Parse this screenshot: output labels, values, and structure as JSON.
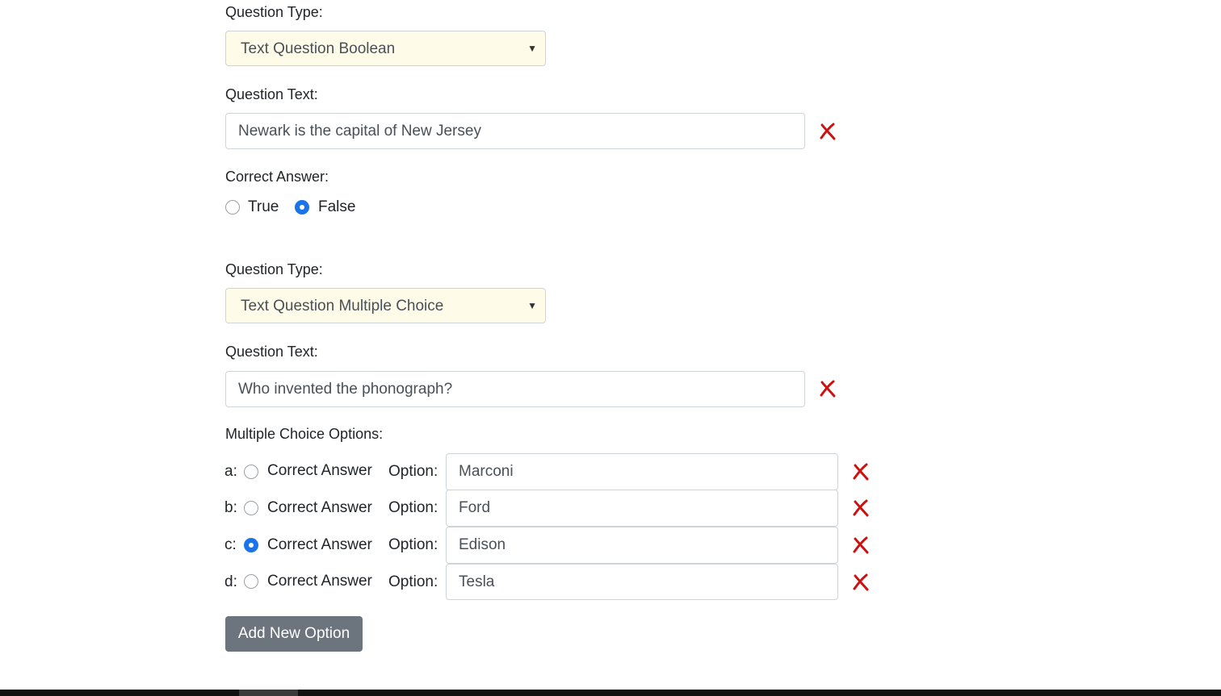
{
  "question1": {
    "type_label": "Question Type:",
    "type_value": "Text Question Boolean",
    "text_label": "Question Text:",
    "text_value": "Newark is the capital of New Jersey",
    "answer_label": "Correct Answer:",
    "answer_options": [
      "True",
      "False"
    ],
    "selected_answer": "False"
  },
  "question2": {
    "type_label": "Question Type:",
    "type_value": "Text Question Multiple Choice",
    "text_label": "Question Text:",
    "text_value": "Who invented the phonograph?",
    "options_label": "Multiple Choice Options:",
    "options": [
      {
        "letter": "a:",
        "correct_label": "Correct Answer",
        "option_label": "Option:",
        "value": "Marconi",
        "correct": false
      },
      {
        "letter": "b:",
        "correct_label": "Correct Answer",
        "option_label": "Option:",
        "value": "Ford",
        "correct": false
      },
      {
        "letter": "c:",
        "correct_label": "Correct Answer",
        "option_label": "Option:",
        "value": "Edison",
        "correct": true
      },
      {
        "letter": "d:",
        "correct_label": "Correct Answer",
        "option_label": "Option:",
        "value": "Tesla",
        "correct": false
      }
    ],
    "add_option_label": "Add New Option"
  },
  "icons": {
    "delete": "close-icon",
    "select_caret": "caret-down-icon"
  },
  "colors": {
    "select_bg": "#fefbe8",
    "radio_selected": "#1a73e8",
    "delete_icon": "#cc1111",
    "button_bg": "#6c757d"
  }
}
